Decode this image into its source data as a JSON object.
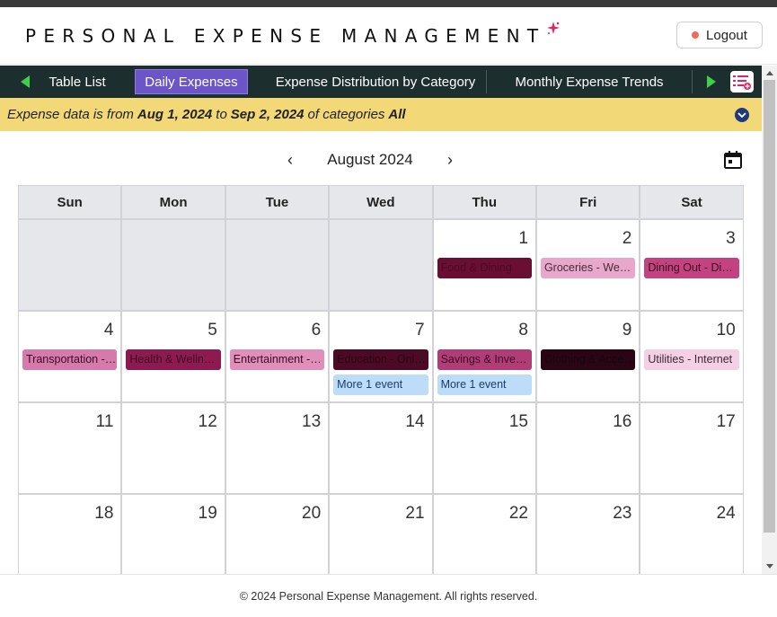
{
  "header": {
    "brand": "PERSONAL EXPENSE MANAGEMENT",
    "logout_label": "Logout"
  },
  "tabs": [
    {
      "label": "Table List",
      "active": false
    },
    {
      "label": "Daily Expenses",
      "active": true
    },
    {
      "label": "Expense Distribution by Category",
      "active": false
    },
    {
      "label": "Monthly Expense Trends",
      "active": false
    }
  ],
  "filter": {
    "prefix": "Expense data is from",
    "start_date": "Aug 1, 2024",
    "to_text": "to",
    "end_date": "Sep 2, 2024",
    "of_text": "of categories",
    "category": "All"
  },
  "calendar": {
    "title": "August 2024",
    "prev_symbol": "‹",
    "next_symbol": "›",
    "weekdays": [
      "Sun",
      "Mon",
      "Tue",
      "Wed",
      "Thu",
      "Fri",
      "Sat"
    ],
    "weeks": [
      [
        {
          "day": ""
        },
        {
          "day": ""
        },
        {
          "day": ""
        },
        {
          "day": ""
        },
        {
          "day": "1",
          "events": [
            {
              "text": "Food & Dining",
              "bg": "#6b0e33",
              "color": "#4a0a24"
            }
          ]
        },
        {
          "day": "2",
          "events": [
            {
              "text": "Groceries - Weekly",
              "bg": "#e7a8cb",
              "color": "#4a2a3a"
            }
          ]
        },
        {
          "day": "3",
          "events": [
            {
              "text": "Dining Out - Dinner",
              "bg": "#c2437f",
              "color": "#3d0c24"
            }
          ]
        }
      ],
      [
        {
          "day": "4",
          "events": [
            {
              "text": "Transportation - Fuel",
              "bg": "#d57aab",
              "color": "#3d0c24"
            }
          ]
        },
        {
          "day": "5",
          "events": [
            {
              "text": "Health & Wellness",
              "bg": "#8e1b4f",
              "color": "#3d0c24"
            }
          ]
        },
        {
          "day": "6",
          "events": [
            {
              "text": "Entertainment - Movies",
              "bg": "#df8fba",
              "color": "#3d0c24"
            }
          ]
        },
        {
          "day": "7",
          "events": [
            {
              "text": "Education - Online Course",
              "bg": "#4d0a24",
              "color": "#2a0614"
            }
          ],
          "more": "More 1 event"
        },
        {
          "day": "8",
          "events": [
            {
              "text": "Savings & Investments",
              "bg": "#b03d75",
              "color": "#3d0c24"
            }
          ],
          "more": "More 1 event"
        },
        {
          "day": "9",
          "events": [
            {
              "text": "Clothing & Accessories",
              "bg": "#2a0614",
              "color": "#1a0410"
            }
          ]
        },
        {
          "day": "10",
          "events": [
            {
              "text": "Utilities - Internet",
              "bg": "#f5cfe3",
              "color": "#3d2a33"
            }
          ]
        }
      ],
      [
        {
          "day": "11"
        },
        {
          "day": "12"
        },
        {
          "day": "13"
        },
        {
          "day": "14"
        },
        {
          "day": "15"
        },
        {
          "day": "16"
        },
        {
          "day": "17"
        }
      ],
      [
        {
          "day": "18"
        },
        {
          "day": "19"
        },
        {
          "day": "20"
        },
        {
          "day": "21"
        },
        {
          "day": "22"
        },
        {
          "day": "23"
        },
        {
          "day": "24"
        }
      ]
    ]
  },
  "footer": {
    "text": "© 2024 Personal Expense Management. All rights reserved."
  },
  "icons": {
    "sparkle": "sparkle-icon",
    "tab_prev": "triangle-left-icon",
    "tab_next": "triangle-right-icon",
    "menu": "list-settings-icon",
    "filter_toggle": "chevron-down-icon",
    "calendar_picker": "calendar-icon"
  },
  "colors": {
    "tab_bar": "#1c2f2e",
    "tab_active": "#6c55c9",
    "arrow_green": "#3bd14a",
    "filter_bar": "#f2d877",
    "more_event": "#bcdcf8"
  }
}
